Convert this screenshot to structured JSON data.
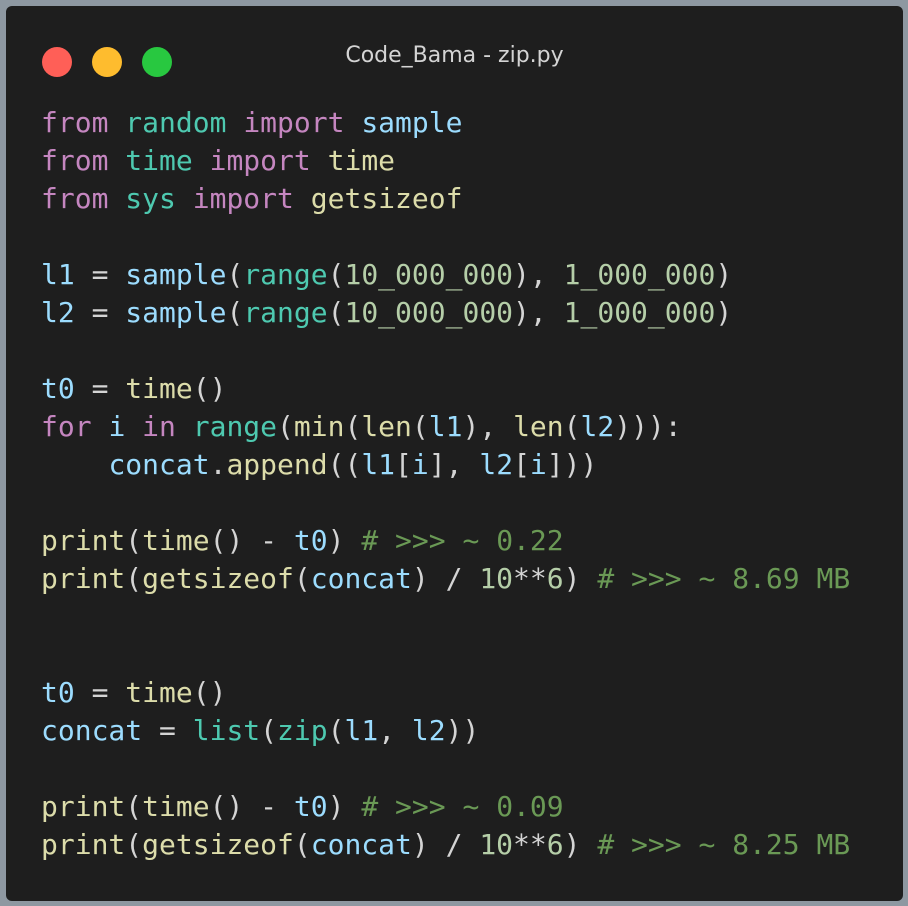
{
  "window": {
    "title": "Code_Bama - zip.py",
    "buttons": {
      "close_color": "#ff5f57",
      "minimize_color": "#febc2e",
      "maximize_color": "#28c840"
    }
  },
  "code": {
    "lines": [
      {
        "tokens": [
          {
            "t": "from",
            "c": "kw"
          },
          {
            "t": " ",
            "c": "op"
          },
          {
            "t": "random",
            "c": "mod"
          },
          {
            "t": " ",
            "c": "op"
          },
          {
            "t": "import",
            "c": "kw"
          },
          {
            "t": " ",
            "c": "op"
          },
          {
            "t": "sample",
            "c": "var"
          }
        ]
      },
      {
        "tokens": [
          {
            "t": "from",
            "c": "kw"
          },
          {
            "t": " ",
            "c": "op"
          },
          {
            "t": "time",
            "c": "mod"
          },
          {
            "t": " ",
            "c": "op"
          },
          {
            "t": "import",
            "c": "kw"
          },
          {
            "t": " ",
            "c": "op"
          },
          {
            "t": "time",
            "c": "fn"
          }
        ]
      },
      {
        "tokens": [
          {
            "t": "from",
            "c": "kw"
          },
          {
            "t": " ",
            "c": "op"
          },
          {
            "t": "sys",
            "c": "mod"
          },
          {
            "t": " ",
            "c": "op"
          },
          {
            "t": "import",
            "c": "kw"
          },
          {
            "t": " ",
            "c": "op"
          },
          {
            "t": "getsizeof",
            "c": "fn"
          }
        ]
      },
      {
        "tokens": []
      },
      {
        "tokens": [
          {
            "t": "l1",
            "c": "var"
          },
          {
            "t": " = ",
            "c": "op"
          },
          {
            "t": "sample",
            "c": "var"
          },
          {
            "t": "(",
            "c": "op"
          },
          {
            "t": "range",
            "c": "mod"
          },
          {
            "t": "(",
            "c": "op"
          },
          {
            "t": "10_000_000",
            "c": "num"
          },
          {
            "t": "), ",
            "c": "op"
          },
          {
            "t": "1_000_000",
            "c": "num"
          },
          {
            "t": ")",
            "c": "op"
          }
        ]
      },
      {
        "tokens": [
          {
            "t": "l2",
            "c": "var"
          },
          {
            "t": " = ",
            "c": "op"
          },
          {
            "t": "sample",
            "c": "var"
          },
          {
            "t": "(",
            "c": "op"
          },
          {
            "t": "range",
            "c": "mod"
          },
          {
            "t": "(",
            "c": "op"
          },
          {
            "t": "10_000_000",
            "c": "num"
          },
          {
            "t": "), ",
            "c": "op"
          },
          {
            "t": "1_000_000",
            "c": "num"
          },
          {
            "t": ")",
            "c": "op"
          }
        ]
      },
      {
        "tokens": []
      },
      {
        "tokens": [
          {
            "t": "t0",
            "c": "var"
          },
          {
            "t": " = ",
            "c": "op"
          },
          {
            "t": "time",
            "c": "fn"
          },
          {
            "t": "()",
            "c": "op"
          }
        ]
      },
      {
        "tokens": [
          {
            "t": "for",
            "c": "kw"
          },
          {
            "t": " ",
            "c": "op"
          },
          {
            "t": "i",
            "c": "var"
          },
          {
            "t": " ",
            "c": "op"
          },
          {
            "t": "in",
            "c": "kw"
          },
          {
            "t": " ",
            "c": "op"
          },
          {
            "t": "range",
            "c": "mod"
          },
          {
            "t": "(",
            "c": "op"
          },
          {
            "t": "min",
            "c": "fn"
          },
          {
            "t": "(",
            "c": "op"
          },
          {
            "t": "len",
            "c": "fn"
          },
          {
            "t": "(",
            "c": "op"
          },
          {
            "t": "l1",
            "c": "var"
          },
          {
            "t": "), ",
            "c": "op"
          },
          {
            "t": "len",
            "c": "fn"
          },
          {
            "t": "(",
            "c": "op"
          },
          {
            "t": "l2",
            "c": "var"
          },
          {
            "t": "))):",
            "c": "op"
          }
        ]
      },
      {
        "tokens": [
          {
            "t": "    ",
            "c": "op"
          },
          {
            "t": "concat",
            "c": "var"
          },
          {
            "t": ".",
            "c": "op"
          },
          {
            "t": "append",
            "c": "fn"
          },
          {
            "t": "((",
            "c": "op"
          },
          {
            "t": "l1",
            "c": "var"
          },
          {
            "t": "[",
            "c": "op"
          },
          {
            "t": "i",
            "c": "var"
          },
          {
            "t": "], ",
            "c": "op"
          },
          {
            "t": "l2",
            "c": "var"
          },
          {
            "t": "[",
            "c": "op"
          },
          {
            "t": "i",
            "c": "var"
          },
          {
            "t": "]))",
            "c": "op"
          }
        ]
      },
      {
        "tokens": []
      },
      {
        "tokens": [
          {
            "t": "print",
            "c": "fn"
          },
          {
            "t": "(",
            "c": "op"
          },
          {
            "t": "time",
            "c": "fn"
          },
          {
            "t": "() - ",
            "c": "op"
          },
          {
            "t": "t0",
            "c": "var"
          },
          {
            "t": ") ",
            "c": "op"
          },
          {
            "t": "# >>> ~ 0.22",
            "c": "cmt"
          }
        ]
      },
      {
        "tokens": [
          {
            "t": "print",
            "c": "fn"
          },
          {
            "t": "(",
            "c": "op"
          },
          {
            "t": "getsizeof",
            "c": "fn"
          },
          {
            "t": "(",
            "c": "op"
          },
          {
            "t": "concat",
            "c": "var"
          },
          {
            "t": ") / ",
            "c": "op"
          },
          {
            "t": "10",
            "c": "num"
          },
          {
            "t": "**",
            "c": "op"
          },
          {
            "t": "6",
            "c": "num"
          },
          {
            "t": ") ",
            "c": "op"
          },
          {
            "t": "# >>> ~ 8.69 MB",
            "c": "cmt"
          }
        ]
      },
      {
        "tokens": []
      },
      {
        "tokens": []
      },
      {
        "tokens": [
          {
            "t": "t0",
            "c": "var"
          },
          {
            "t": " = ",
            "c": "op"
          },
          {
            "t": "time",
            "c": "fn"
          },
          {
            "t": "()",
            "c": "op"
          }
        ]
      },
      {
        "tokens": [
          {
            "t": "concat",
            "c": "var"
          },
          {
            "t": " = ",
            "c": "op"
          },
          {
            "t": "list",
            "c": "mod"
          },
          {
            "t": "(",
            "c": "op"
          },
          {
            "t": "zip",
            "c": "mod"
          },
          {
            "t": "(",
            "c": "op"
          },
          {
            "t": "l1",
            "c": "var"
          },
          {
            "t": ", ",
            "c": "op"
          },
          {
            "t": "l2",
            "c": "var"
          },
          {
            "t": "))",
            "c": "op"
          }
        ]
      },
      {
        "tokens": []
      },
      {
        "tokens": [
          {
            "t": "print",
            "c": "fn"
          },
          {
            "t": "(",
            "c": "op"
          },
          {
            "t": "time",
            "c": "fn"
          },
          {
            "t": "() - ",
            "c": "op"
          },
          {
            "t": "t0",
            "c": "var"
          },
          {
            "t": ") ",
            "c": "op"
          },
          {
            "t": "# >>> ~ 0.09",
            "c": "cmt"
          }
        ]
      },
      {
        "tokens": [
          {
            "t": "print",
            "c": "fn"
          },
          {
            "t": "(",
            "c": "op"
          },
          {
            "t": "getsizeof",
            "c": "fn"
          },
          {
            "t": "(",
            "c": "op"
          },
          {
            "t": "concat",
            "c": "var"
          },
          {
            "t": ") / ",
            "c": "op"
          },
          {
            "t": "10",
            "c": "num"
          },
          {
            "t": "**",
            "c": "op"
          },
          {
            "t": "6",
            "c": "num"
          },
          {
            "t": ") ",
            "c": "op"
          },
          {
            "t": "# >>> ~ 8.25 MB",
            "c": "cmt"
          }
        ]
      }
    ]
  }
}
